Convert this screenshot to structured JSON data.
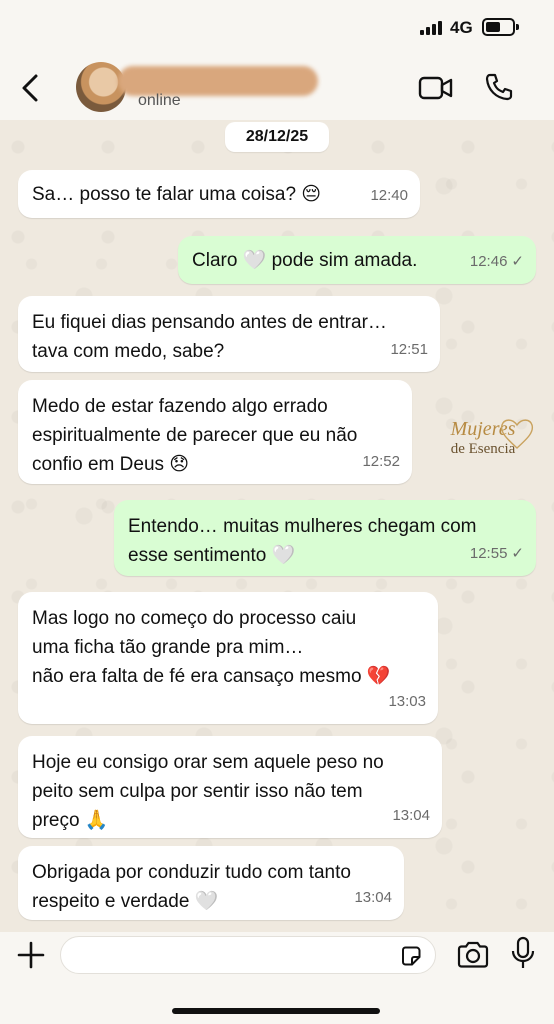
{
  "status_bar": {
    "network": "4G"
  },
  "header": {
    "status": "online",
    "icons": {
      "back": "back-chevron-icon",
      "video": "video-call-icon",
      "call": "phone-call-icon"
    }
  },
  "date_chip": "28/12/25",
  "messages": [
    {
      "dir": "in",
      "lines": [
        "Sa… posso te falar uma coisa? 😔"
      ],
      "time": "12:40"
    },
    {
      "dir": "out",
      "lines": [
        "Claro 🤍 pode sim amada."
      ],
      "time": "12:46",
      "tick": "✓"
    },
    {
      "dir": "in",
      "lines": [
        "Eu fiquei dias pensando antes de entrar…",
        "tava com medo, sabe?"
      ],
      "time": "12:51"
    },
    {
      "dir": "in",
      "lines": [
        "Medo de estar fazendo algo errado",
        "espiritualmente de parecer que eu não",
        "confio em Deus 😞"
      ],
      "time": "12:52"
    },
    {
      "dir": "out",
      "lines": [
        "Entendo… muitas mulheres chegam com",
        "esse sentimento 🤍"
      ],
      "time": "12:55",
      "tick": "✓"
    },
    {
      "dir": "in",
      "lines": [
        "Mas logo no começo do processo caiu",
        "uma ficha tão grande pra mim…",
        "não era falta de fé era cansaço mesmo 💔"
      ],
      "time": "13:03"
    },
    {
      "dir": "in",
      "lines": [
        "Hoje eu consigo orar sem aquele peso no",
        "peito sem culpa por sentir isso não tem",
        "preço 🙏"
      ],
      "time": "13:04"
    },
    {
      "dir": "in",
      "lines": [
        "Obrigada por conduzir tudo com tanto",
        "respeito e verdade 🤍"
      ],
      "time": "13:04"
    }
  ],
  "watermark": {
    "line1": "Mujeres",
    "line2": "de Esencia"
  },
  "input_bar": {
    "placeholder": "",
    "icons": {
      "attach": "plus-icon",
      "sticker": "sticker-icon",
      "camera": "camera-icon",
      "mic": "microphone-icon"
    }
  },
  "colors": {
    "incoming": "#ffffff",
    "outgoing": "#d9fdd3",
    "wallpaper": "#efe9df"
  }
}
